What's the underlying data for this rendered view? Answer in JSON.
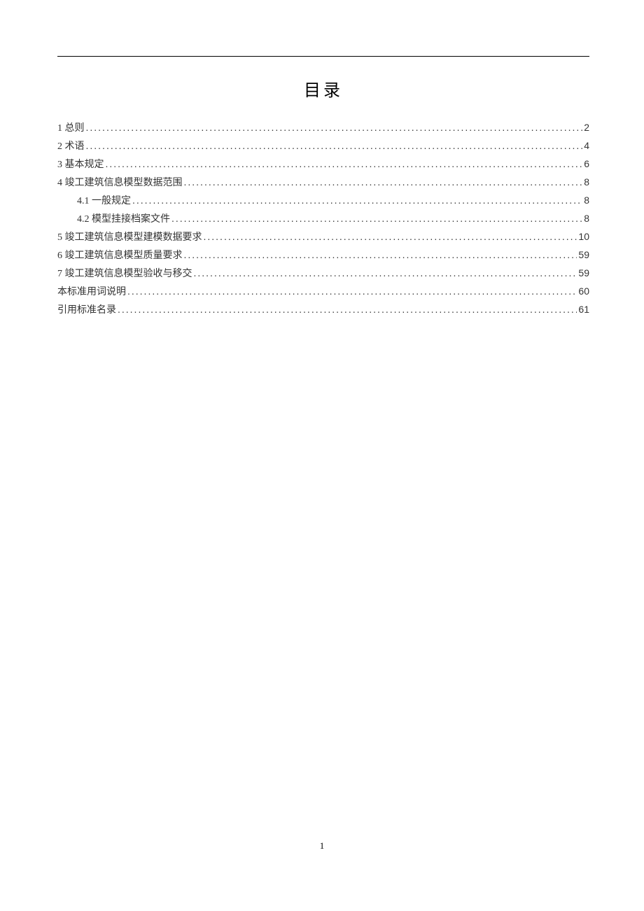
{
  "toc": {
    "title": "目录",
    "entries": [
      {
        "label": "1 总则",
        "page": "2",
        "indent": 0
      },
      {
        "label": "2 术语",
        "page": "4",
        "indent": 0
      },
      {
        "label": "3 基本规定",
        "page": "6",
        "indent": 0
      },
      {
        "label": "4 竣工建筑信息模型数据范围",
        "page": "8",
        "indent": 0
      },
      {
        "label": "4.1 一般规定",
        "page": "8",
        "indent": 1
      },
      {
        "label": "4.2 模型挂接档案文件",
        "page": "8",
        "indent": 1
      },
      {
        "label": "5 竣工建筑信息模型建模数据要求",
        "page": "10",
        "indent": 0
      },
      {
        "label": "6 竣工建筑信息模型质量要求",
        "page": "59",
        "indent": 0
      },
      {
        "label": "7 竣工建筑信息模型验收与移交",
        "page": "59",
        "indent": 0
      },
      {
        "label": "本标准用词说明",
        "page": "60",
        "indent": 0
      },
      {
        "label": "引用标准名录",
        "page": "61",
        "indent": 0
      }
    ]
  },
  "pageNumber": "1"
}
